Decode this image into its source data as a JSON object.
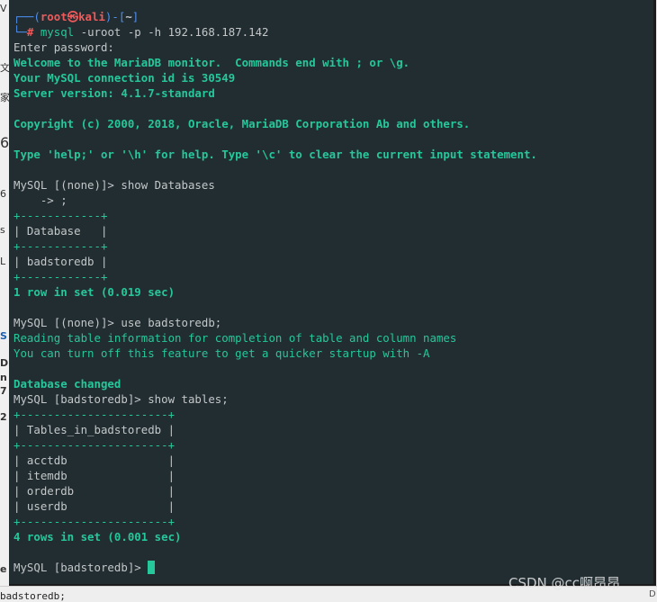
{
  "behind_window": {
    "glyphs": [
      "ᐯ",
      "文",
      "家",
      "6",
      "6",
      "s",
      "L",
      "S",
      "D",
      "n",
      "7",
      "2",
      "e"
    ],
    "bottom_text": "badstoredb;",
    "bottom_edge_letter": "D"
  },
  "terminal": {
    "prompt": {
      "corner_top": "┌──(",
      "user": "root",
      "symbol": "㉿",
      "host": "kali",
      "sep": ")-[",
      "dir": "~",
      "close": "]",
      "corner_bottom": "└─",
      "hash": "# ",
      "command": "mysql",
      "args": " -uroot -p -h 192.168.187.142"
    },
    "lines": {
      "l03": "Enter password:",
      "l04": "Welcome to the MariaDB monitor.  Commands end with ; or \\g.",
      "l05": "Your MySQL connection id is 30549",
      "l06": "Server version: 4.1.7-standard",
      "l08": "Copyright (c) 2000, 2018, Oracle, MariaDB Corporation Ab and others.",
      "l10": "Type 'help;' or '\\h' for help. Type '\\c' to clear the current input statement.",
      "l12": "MySQL [(none)]> show Databases",
      "l13": "    -> ;",
      "l14": "+------------+",
      "l15": "| Database   |",
      "l16": "+------------+",
      "l17": "| badstoredb |",
      "l18": "+------------+",
      "l19": "1 row in set (0.019 sec)",
      "l21": "MySQL [(none)]> use badstoredb;",
      "l22": "Reading table information for completion of table and column names",
      "l23": "You can turn off this feature to get a quicker startup with -A",
      "l25": "Database changed",
      "l26": "MySQL [badstoredb]> show tables;",
      "l27": "+----------------------+",
      "l28": "| Tables_in_badstoredb |",
      "l29": "+----------------------+",
      "l30": "| acctdb               |",
      "l31": "| itemdb               |",
      "l32": "| orderdb              |",
      "l33": "| userdb               |",
      "l34": "+----------------------+",
      "l35": "4 rows in set (0.001 sec)",
      "l37": "MySQL [badstoredb]> "
    }
  },
  "watermark": "CSDN @cc啊昂昂",
  "colors": {
    "terminal_bg": "#222d32",
    "green": "#26c79a",
    "red": "#f05a5a",
    "blue": "#4d8ff0",
    "text": "#c3c7c9"
  }
}
